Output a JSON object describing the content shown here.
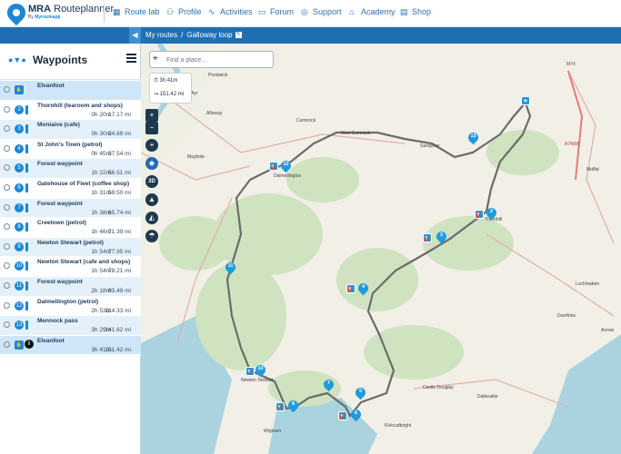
{
  "brand": {
    "name_bold": "MRA",
    "name_rest": " Routeplanner",
    "sub_prefix": "By ",
    "sub_company": "Myrouteapp"
  },
  "nav": [
    {
      "label": "Route lab",
      "icon": "route-lab-icon"
    },
    {
      "label": "Profile",
      "icon": "profile-icon"
    },
    {
      "label": "Activities",
      "icon": "activities-icon"
    },
    {
      "label": "Forum",
      "icon": "forum-icon"
    },
    {
      "label": "Support",
      "icon": "support-icon"
    },
    {
      "label": "Academy",
      "icon": "academy-icon"
    },
    {
      "label": "Shop",
      "icon": "shop-icon"
    }
  ],
  "breadcrumb": {
    "parent": "My routes",
    "separator": "/",
    "current": "Galloway loop"
  },
  "sidebar": {
    "title": "Waypoints"
  },
  "waypoints": [
    {
      "name": "Elvanfoot",
      "time": "",
      "dist": "",
      "marker": "start"
    },
    {
      "name": "Thornhill (tearoom and shops)",
      "time": "0h 20m",
      "dist": "17.17 mi",
      "marker": "2"
    },
    {
      "name": "Moniaive (cafe)",
      "time": "0h 30m",
      "dist": "24.69 mi",
      "marker": "3"
    },
    {
      "name": "St John's Town (petrol)",
      "time": "0h 45m",
      "dist": "37.54 mi",
      "marker": "4"
    },
    {
      "name": "Forest waypoint",
      "time": "1h 22m",
      "dist": "56.51 mi",
      "marker": "5"
    },
    {
      "name": "Gatehouse of Fleet (coffee shop)",
      "time": "1h 31m",
      "dist": "59.50 mi",
      "marker": "6"
    },
    {
      "name": "Forest waypoint",
      "time": "1h 38m",
      "dist": "65.74 mi",
      "marker": "7"
    },
    {
      "name": "Creetown (petrol)",
      "time": "1h 46m",
      "dist": "71.39 mi",
      "marker": "8"
    },
    {
      "name": "Newton Stewart (petrol)",
      "time": "1h 54m",
      "dist": "77.95 mi",
      "marker": "9"
    },
    {
      "name": "Newton Stewart (cafe and shops)",
      "time": "1h 54m",
      "dist": "78.21 mi",
      "marker": "10"
    },
    {
      "name": "Forest waypoint",
      "time": "2h 18m",
      "dist": "93.49 mi",
      "marker": "11"
    },
    {
      "name": "Dalmellington (petrol)",
      "time": "2h 53m",
      "dist": "114.33 mi",
      "marker": "12"
    },
    {
      "name": "Mennock pass",
      "time": "3h 29m",
      "dist": "141.62 mi",
      "marker": "13"
    },
    {
      "name": "Elvanfoot",
      "time": "3h 41m",
      "dist": "151.42 mi",
      "marker": "finish"
    }
  ],
  "search": {
    "placeholder": "Find a place..."
  },
  "stats": {
    "duration": "3h 41m",
    "distance": "151.42 mi"
  },
  "map_controls": {
    "zoom_in": "+",
    "zoom_out": "−",
    "three_d": "3D"
  },
  "map_pins": [
    "2",
    "3",
    "4",
    "5",
    "6",
    "7",
    "8",
    "10",
    "11",
    "12",
    "13"
  ],
  "places": [
    "Prestwick",
    "Ayr",
    "Alloway",
    "Cumnock",
    "Maybole",
    "Dalmellington",
    "New Cumnock",
    "Sanquhar",
    "Thornhill",
    "Moffat",
    "Lochmaben",
    "Dumfries",
    "Newton Stewart",
    "Wigtown",
    "Castle Douglas",
    "Dalbeattie",
    "Kirkcudbright",
    "Annan",
    "M74",
    "A74(M)"
  ],
  "colors": {
    "accent": "#1b87d6",
    "bar": "#1f6fb3",
    "route": "#6b6b6b"
  }
}
